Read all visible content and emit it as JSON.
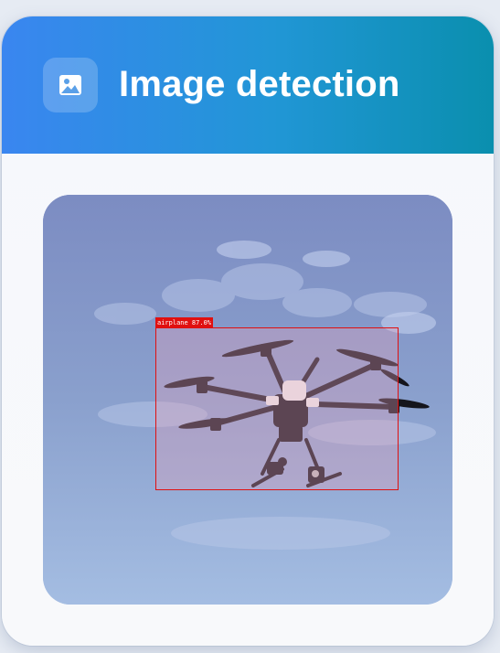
{
  "header": {
    "title": "Image detection",
    "icon": "image-icon",
    "gradient_start": "#3a86f0",
    "gradient_end": "#0a8fae"
  },
  "detection": {
    "label": "airplane 87.0%",
    "box_color": "#e01010"
  },
  "image": {
    "subject": "drone"
  }
}
